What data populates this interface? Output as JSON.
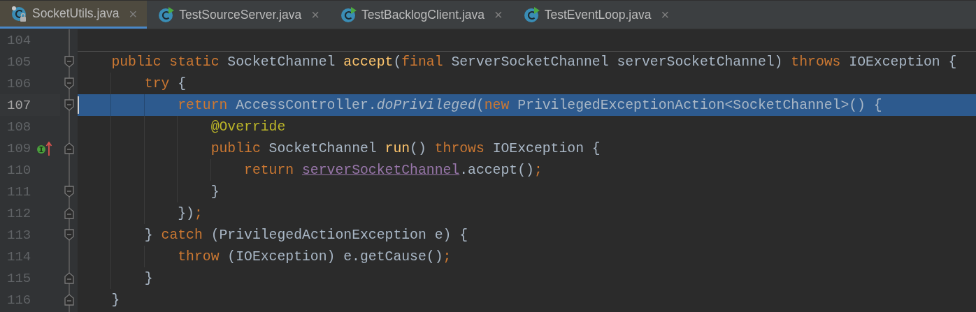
{
  "tabs": [
    {
      "label": "SocketUtils.java",
      "selected": true,
      "kind": "locked"
    },
    {
      "label": "TestSourceServer.java",
      "selected": false,
      "kind": "runnable"
    },
    {
      "label": "TestBacklogClient.java",
      "selected": false,
      "kind": "runnable"
    },
    {
      "label": "TestEventLoop.java",
      "selected": false,
      "kind": "runnable"
    }
  ],
  "close_glyph": "×",
  "lines": [
    {
      "number": "104",
      "current": false
    },
    {
      "number": "105",
      "current": false,
      "method_separator": true,
      "fold_marker": {
        "kind": "start"
      },
      "tokens": [
        {
          "kind": "keyword",
          "text": "    public static "
        },
        {
          "kind": "plain",
          "text": "SocketChannel "
        },
        {
          "kind": "method",
          "text": "accept"
        },
        {
          "kind": "plain",
          "text": "("
        },
        {
          "kind": "keyword",
          "text": "final "
        },
        {
          "kind": "plain",
          "text": "ServerSocketChannel serverSocketChannel) "
        },
        {
          "kind": "keyword",
          "text": "throws "
        },
        {
          "kind": "plain",
          "text": "IOException {"
        }
      ]
    },
    {
      "number": "106",
      "current": false,
      "fold_marker": {
        "kind": "start"
      },
      "tokens": [
        {
          "kind": "keyword",
          "text": "        try "
        },
        {
          "kind": "plain",
          "text": "{"
        }
      ]
    },
    {
      "number": "107",
      "current": true,
      "fold_marker": {
        "kind": "start"
      },
      "tokens": [
        {
          "kind": "keyword",
          "text": "            return "
        },
        {
          "kind": "plain",
          "text": "AccessController."
        },
        {
          "kind": "static_call",
          "text": "doPrivileged"
        },
        {
          "kind": "plain",
          "text": "("
        },
        {
          "kind": "keyword",
          "text": "new "
        },
        {
          "kind": "plain",
          "text": "PrivilegedExceptionAction<SocketChannel>() {"
        }
      ]
    },
    {
      "number": "108",
      "current": false,
      "tokens": [
        {
          "kind": "annotation",
          "text": "                @Override"
        }
      ]
    },
    {
      "number": "109",
      "current": false,
      "fold_marker": {
        "kind": "end"
      },
      "gutter_icon": {
        "kind": "overrides"
      },
      "tokens": [
        {
          "kind": "keyword",
          "text": "                public "
        },
        {
          "kind": "plain",
          "text": "SocketChannel "
        },
        {
          "kind": "method",
          "text": "run"
        },
        {
          "kind": "plain",
          "text": "() "
        },
        {
          "kind": "keyword",
          "text": "throws "
        },
        {
          "kind": "plain",
          "text": "IOException {"
        }
      ]
    },
    {
      "number": "110",
      "current": false,
      "tokens": [
        {
          "kind": "keyword",
          "text": "                    return "
        },
        {
          "kind": "field",
          "text": "serverSocketChannel"
        },
        {
          "kind": "plain",
          "text": ".accept()"
        },
        {
          "kind": "keyword",
          "text": ";"
        }
      ]
    },
    {
      "number": "111",
      "current": false,
      "fold_marker": {
        "kind": "start"
      },
      "tokens": [
        {
          "kind": "plain",
          "text": "                }"
        }
      ]
    },
    {
      "number": "112",
      "current": false,
      "fold_marker": {
        "kind": "end"
      },
      "tokens": [
        {
          "kind": "plain",
          "text": "            })"
        },
        {
          "kind": "keyword",
          "text": ";"
        }
      ]
    },
    {
      "number": "113",
      "current": false,
      "fold_marker": {
        "kind": "start"
      },
      "tokens": [
        {
          "kind": "plain",
          "text": "        } "
        },
        {
          "kind": "keyword",
          "text": "catch "
        },
        {
          "kind": "plain",
          "text": "(PrivilegedActionException e) {"
        }
      ]
    },
    {
      "number": "114",
      "current": false,
      "tokens": [
        {
          "kind": "keyword",
          "text": "            throw "
        },
        {
          "kind": "plain",
          "text": "(IOException) e.getCause()"
        },
        {
          "kind": "keyword",
          "text": ";"
        }
      ]
    },
    {
      "number": "115",
      "current": false,
      "fold_marker": {
        "kind": "end"
      },
      "tokens": [
        {
          "kind": "plain",
          "text": "        }"
        }
      ]
    },
    {
      "number": "116",
      "current": false,
      "fold_marker": {
        "kind": "end"
      },
      "tokens": [
        {
          "kind": "plain",
          "text": "    }"
        }
      ]
    }
  ]
}
